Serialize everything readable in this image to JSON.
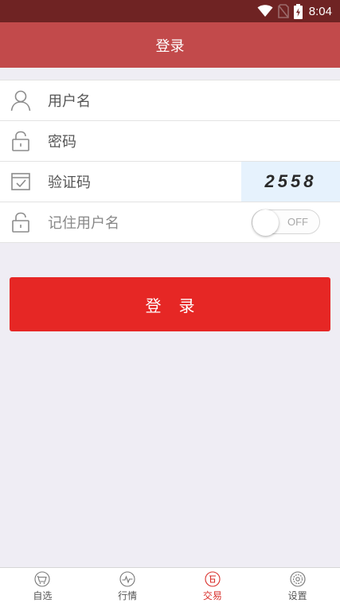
{
  "status_bar": {
    "time": "8:04",
    "icons": [
      "wifi-icon",
      "no-sim-icon",
      "battery-charging-icon"
    ]
  },
  "header": {
    "title": "登录"
  },
  "form": {
    "username_placeholder": "用户名",
    "password_placeholder": "密码",
    "captcha_placeholder": "验证码",
    "captcha_code": "2558",
    "remember_label": "记住用户名",
    "remember_toggle_text": "OFF"
  },
  "login_button": {
    "label": "登录"
  },
  "tabbar": {
    "items": [
      {
        "label": "自选",
        "icon": "basket-icon",
        "active": false
      },
      {
        "label": "行情",
        "icon": "pulse-icon",
        "active": false
      },
      {
        "label": "交易",
        "icon": "trade-icon",
        "active": true
      },
      {
        "label": "设置",
        "icon": "settings-icon",
        "active": false
      }
    ]
  },
  "colors": {
    "status_bar": "#6f2323",
    "header": "#c24a4b",
    "accent": "#e62725",
    "active_tab": "#d9302c",
    "background": "#efedf4"
  }
}
